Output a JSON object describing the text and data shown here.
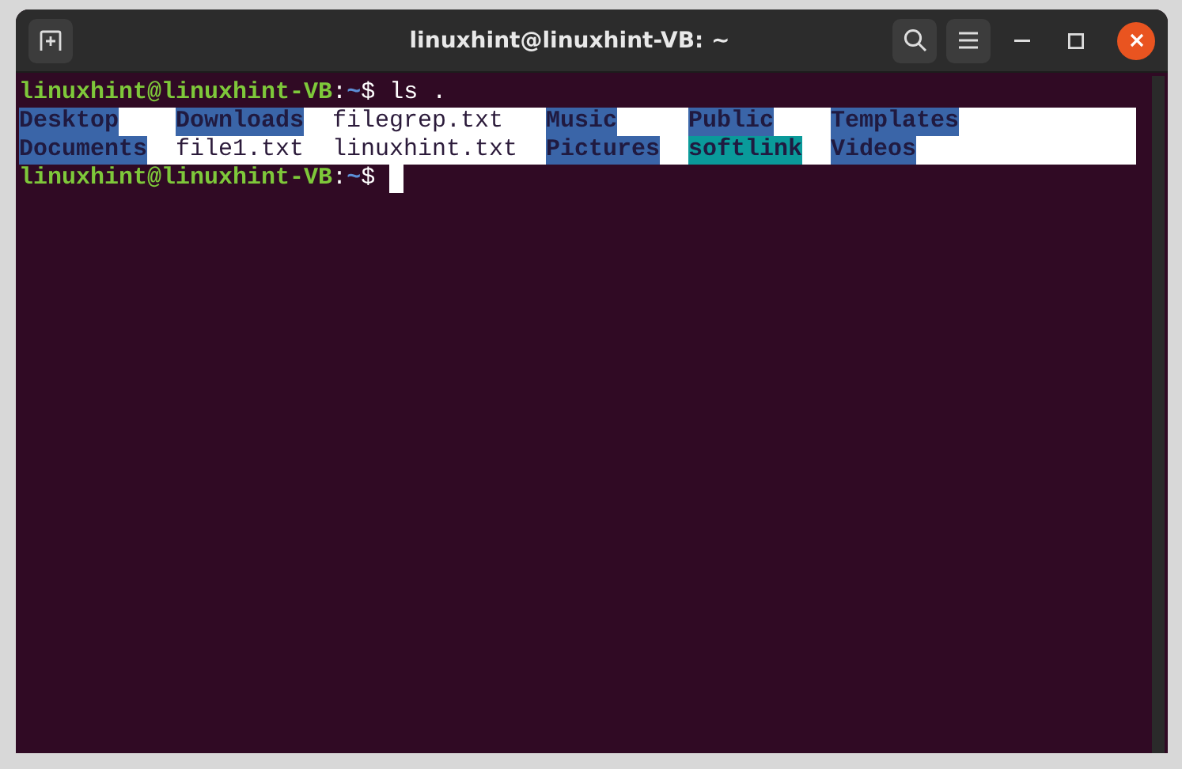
{
  "window": {
    "title": "linuxhint@linuxhint-VB: ~"
  },
  "terminal": {
    "lines": [
      {
        "kind": "prompt",
        "user": "linuxhint@linuxhint-VB",
        "separator": ":",
        "path": "~",
        "symbol": "$",
        "command": "ls ."
      },
      {
        "kind": "listing",
        "rows": [
          [
            {
              "name": "Desktop",
              "kind": "dir"
            },
            {
              "name": "Downloads",
              "kind": "dir"
            },
            {
              "name": "filegrep.txt",
              "kind": "file"
            },
            {
              "name": "Music",
              "kind": "dir"
            },
            {
              "name": "Public",
              "kind": "dir"
            },
            {
              "name": "Templates",
              "kind": "dir"
            }
          ],
          [
            {
              "name": "Documents",
              "kind": "dir"
            },
            {
              "name": "file1.txt",
              "kind": "file"
            },
            {
              "name": "linuxhint.txt",
              "kind": "file"
            },
            {
              "name": "Pictures",
              "kind": "dir"
            },
            {
              "name": "softlink",
              "kind": "link"
            },
            {
              "name": "Videos",
              "kind": "dir"
            }
          ]
        ]
      },
      {
        "kind": "prompt",
        "user": "linuxhint@linuxhint-VB",
        "separator": ":",
        "path": "~",
        "symbol": "$",
        "cursor": true
      }
    ]
  }
}
